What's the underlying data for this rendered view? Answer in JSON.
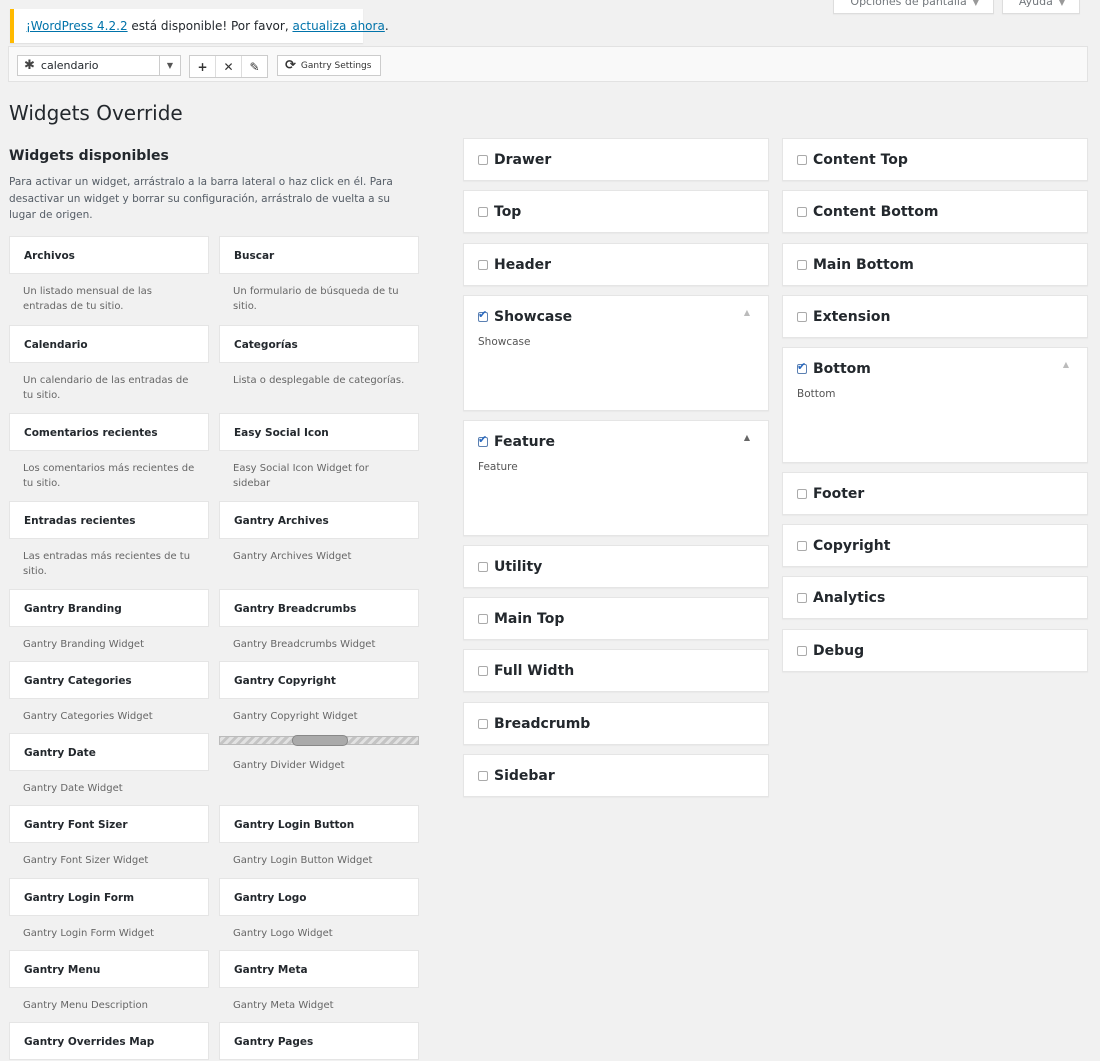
{
  "top_tabs": [
    {
      "label": "Opciones de pantalla"
    },
    {
      "label": "Ayuda"
    }
  ],
  "notice": {
    "link1": "¡WordPress 4.2.2",
    "text": " está disponible! Por favor, ",
    "link2": "actualiza ahora",
    "end": "."
  },
  "toolbar": {
    "selected": "calendario",
    "add": "+",
    "remove": "✕",
    "edit": "✎",
    "gantry_settings": "Gantry Settings"
  },
  "page_title": "Widgets Override",
  "available": {
    "title": "Widgets disponibles",
    "description": "Para activar un widget, arrástralo a la barra lateral o haz click en él. Para desactivar un widget y borrar su configuración, arrástralo de vuelta a su lugar de origen.",
    "widgets": [
      {
        "name": "Archivos",
        "desc": "Un listado mensual de las entradas de tu sitio."
      },
      {
        "name": "Buscar",
        "desc": "Un formulario de búsqueda de tu sitio."
      },
      {
        "name": "Calendario",
        "desc": "Un calendario de las entradas de tu sitio."
      },
      {
        "name": "Categorías",
        "desc": "Lista o desplegable de categorías."
      },
      {
        "name": "Comentarios recientes",
        "desc": "Los comentarios más recientes de tu sitio."
      },
      {
        "name": "Easy Social Icon",
        "desc": "Easy Social Icon Widget for sidebar"
      },
      {
        "name": "Entradas recientes",
        "desc": "Las entradas más recientes de tu sitio."
      },
      {
        "name": "Gantry Archives",
        "desc": "Gantry Archives Widget"
      },
      {
        "name": "Gantry Branding",
        "desc": "Gantry Branding Widget"
      },
      {
        "name": "Gantry Breadcrumbs",
        "desc": "Gantry Breadcrumbs Widget"
      },
      {
        "name": "Gantry Categories",
        "desc": "Gantry Categories Widget"
      },
      {
        "name": "Gantry Copyright",
        "desc": "Gantry Copyright Widget"
      },
      {
        "name": "Gantry Date",
        "desc": "Gantry Date Widget"
      },
      {
        "name": "",
        "desc": "Gantry Divider Widget"
      },
      {
        "name": "Gantry Font Sizer",
        "desc": "Gantry Font Sizer Widget"
      },
      {
        "name": "Gantry Login Button",
        "desc": "Gantry Login Button Widget"
      },
      {
        "name": "Gantry Login Form",
        "desc": "Gantry Login Form Widget"
      },
      {
        "name": "Gantry Logo",
        "desc": "Gantry Logo Widget"
      },
      {
        "name": "Gantry Menu",
        "desc": "Gantry Menu Description"
      },
      {
        "name": "Gantry Meta",
        "desc": "Gantry Meta Widget"
      },
      {
        "name": "Gantry Overrides Map",
        "desc": ""
      },
      {
        "name": "Gantry Pages",
        "desc": ""
      }
    ]
  },
  "positions_col1": [
    {
      "name": "Drawer",
      "checked": false
    },
    {
      "name": "Top",
      "checked": false
    },
    {
      "name": "Header",
      "checked": false
    },
    {
      "name": "Showcase",
      "checked": true,
      "sub": "Showcase"
    },
    {
      "name": "Feature",
      "checked": true,
      "sub": "Feature"
    },
    {
      "name": "Utility",
      "checked": false
    },
    {
      "name": "Main Top",
      "checked": false
    },
    {
      "name": "Full Width",
      "checked": false
    },
    {
      "name": "Breadcrumb",
      "checked": false
    },
    {
      "name": "Sidebar",
      "checked": false
    }
  ],
  "positions_col2": [
    {
      "name": "Content Top",
      "checked": false
    },
    {
      "name": "Content Bottom",
      "checked": false
    },
    {
      "name": "Main Bottom",
      "checked": false
    },
    {
      "name": "Extension",
      "checked": false
    },
    {
      "name": "Bottom",
      "checked": true,
      "sub": "Bottom"
    },
    {
      "name": "Footer",
      "checked": false
    },
    {
      "name": "Copyright",
      "checked": false
    },
    {
      "name": "Analytics",
      "checked": false
    },
    {
      "name": "Debug",
      "checked": false
    }
  ]
}
